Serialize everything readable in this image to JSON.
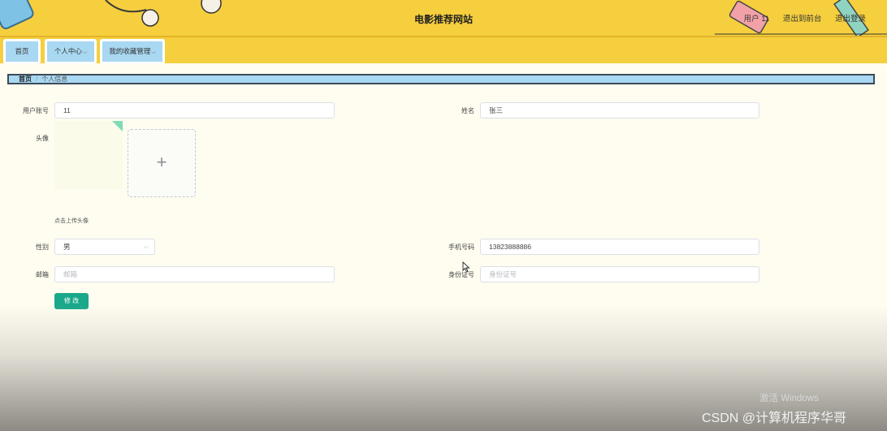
{
  "header": {
    "title": "电影推荐网站",
    "user": "用户 11",
    "back_to_front": "退出到前台",
    "logout": "退出登录"
  },
  "nav": {
    "items": [
      {
        "label": "首页"
      },
      {
        "label": "个人中心"
      },
      {
        "label": "我的收藏管理"
      }
    ]
  },
  "breadcrumb": {
    "home": "首页",
    "separator": "/",
    "current": "个人信息"
  },
  "form": {
    "username": {
      "label": "用户账号",
      "value": "11"
    },
    "name": {
      "label": "姓名",
      "value": "张三"
    },
    "avatar": {
      "label": "头像",
      "upload_icon": "+",
      "hint": "点击上传头像"
    },
    "gender": {
      "label": "性别",
      "value": "男"
    },
    "phone": {
      "label": "手机号码",
      "value": "13823888886"
    },
    "email": {
      "label": "邮箱",
      "placeholder": "邮箱"
    },
    "id_card": {
      "label": "身份证号",
      "placeholder": "身份证号"
    },
    "submit_label": "修 改"
  },
  "watermark": {
    "activate": "激活 Windows",
    "csdn": "CSDN @计算机程序华哥"
  },
  "colors": {
    "header_bg": "#f6cf3e",
    "nav_button_bg": "#a9d8f2",
    "submit_bg": "#1aa88a",
    "page_bg": "#fffdf0"
  }
}
